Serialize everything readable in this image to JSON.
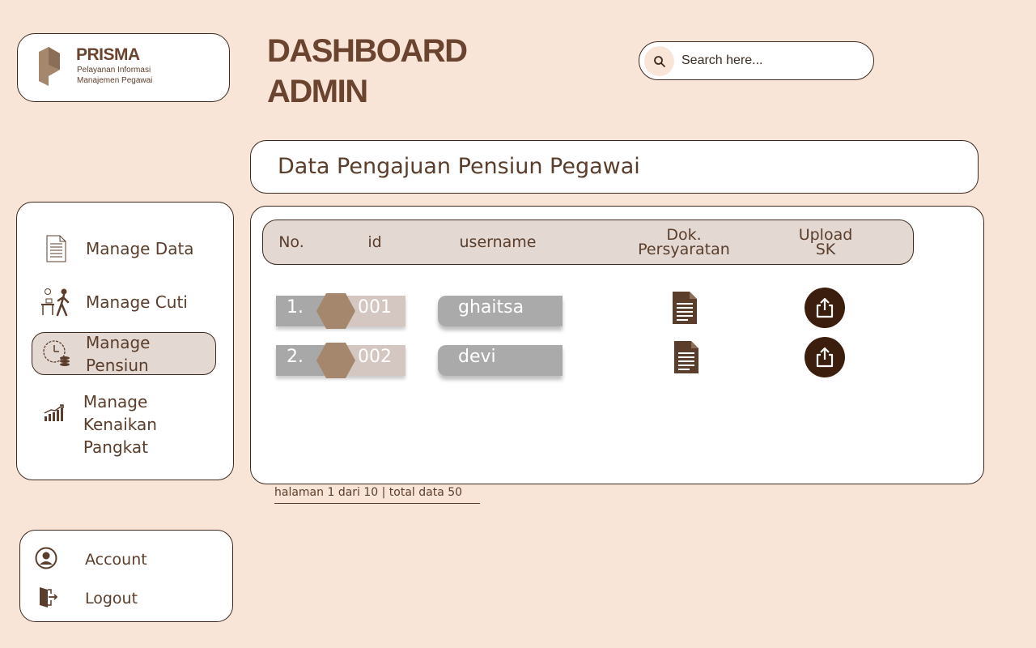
{
  "brand": {
    "name": "PRISMA",
    "subtitle_line1": "Pelayanan Informasi",
    "subtitle_line2": "Manajemen Pegawai"
  },
  "header": {
    "title_line1": "DASHBOARD",
    "title_line2": "ADMIN"
  },
  "search": {
    "placeholder": "Search here...",
    "icon": "search-icon"
  },
  "section": {
    "title": "Data Pengajuan Pensiun Pegawai"
  },
  "sidebar": {
    "items": [
      {
        "label": "Manage Data",
        "icon": "document-icon",
        "active": false
      },
      {
        "label": "Manage Cuti",
        "icon": "leave-person-icon",
        "active": false
      },
      {
        "label": "Manage Pensiun",
        "icon": "clock-coins-icon",
        "active": true
      },
      {
        "label_line1": "Manage Kenaikan",
        "label_line2": "Pangkat",
        "icon": "growth-chart-icon",
        "active": false
      }
    ]
  },
  "table": {
    "columns": {
      "no": "No.",
      "id": "id",
      "username": "username",
      "dok_line1": "Dok.",
      "dok_line2": "Persyaratan",
      "upload_line1": "Upload",
      "upload_line2": "SK"
    },
    "rows": [
      {
        "no": "1.",
        "id": "001",
        "username": "ghaitsa"
      },
      {
        "no": "2.",
        "id": "002",
        "username": "devi"
      }
    ]
  },
  "pager": {
    "text": "halaman 1 dari 10 | total data 50"
  },
  "account_menu": {
    "account": "Account",
    "logout": "Logout"
  },
  "colors": {
    "background": "#f8e5d8",
    "brand_brown": "#6b4430",
    "dark_brown": "#3c1e0e",
    "active_item": "#e3d8d2",
    "accent_hex": "#a4876c"
  }
}
